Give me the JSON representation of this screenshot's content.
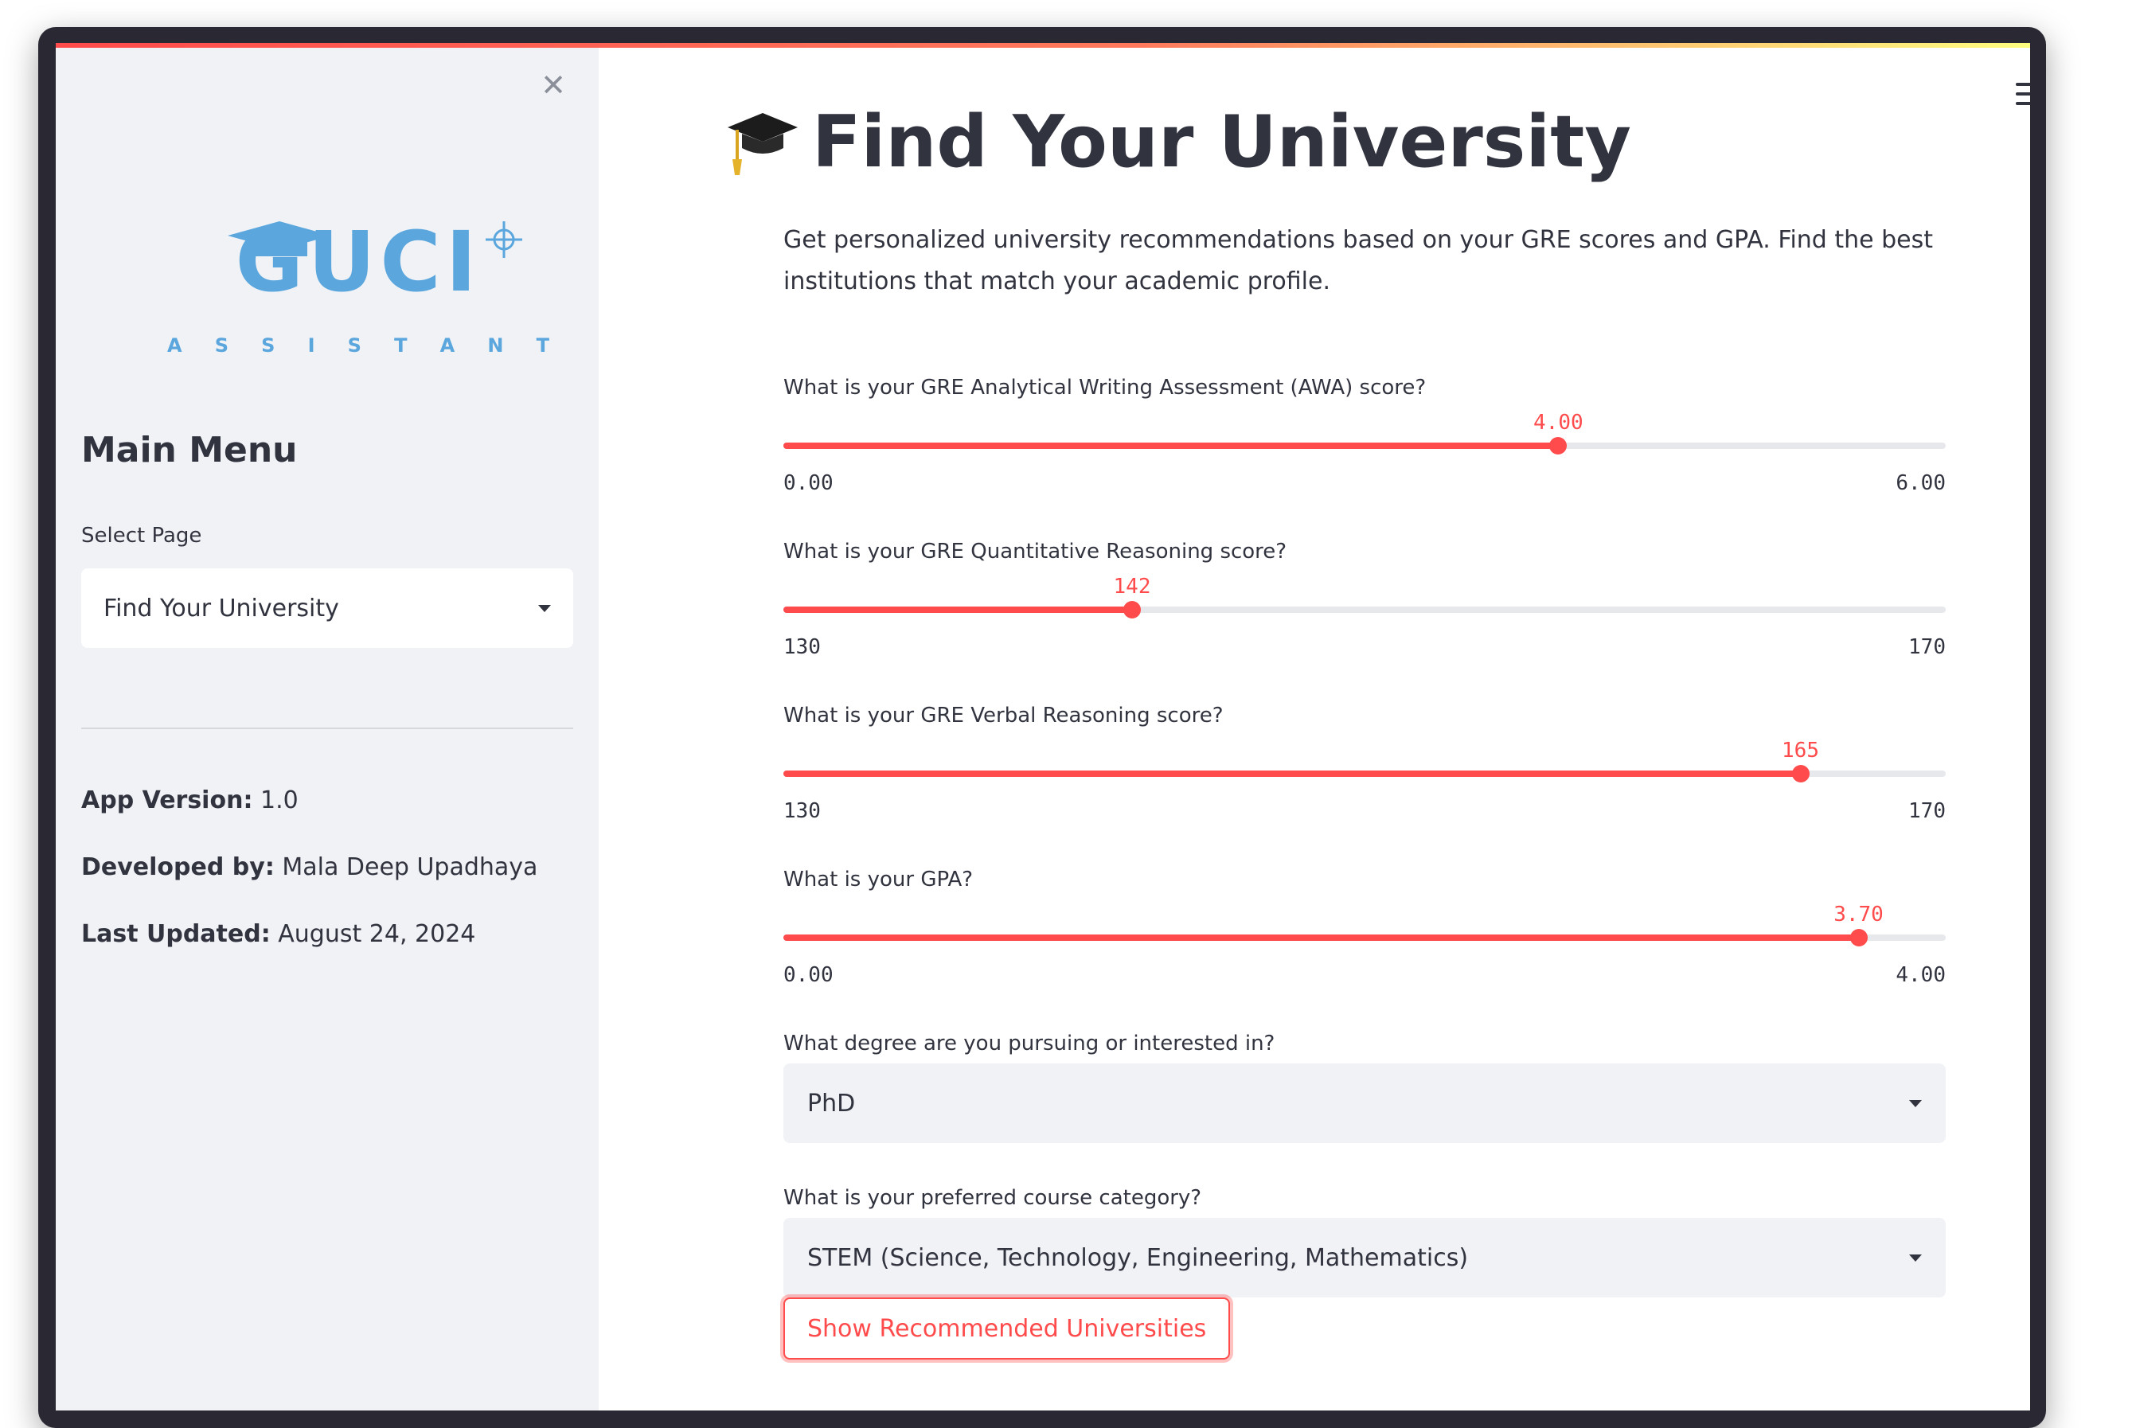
{
  "sidebar": {
    "logo_text": "GUCI",
    "logo_subtext": [
      "A",
      "S",
      "S",
      "I",
      "S",
      "T",
      "A",
      "N",
      "T"
    ],
    "menu_heading": "Main Menu",
    "select_label": "Select Page",
    "selected_page": "Find Your University",
    "app_version_label": "App Version:",
    "app_version_value": "1.0",
    "developed_by_label": "Developed by:",
    "developed_by_value": "Mala Deep Upadhaya",
    "last_updated_label": "Last Updated:",
    "last_updated_value": "August 24, 2024"
  },
  "main": {
    "title": "Find Your University",
    "intro": "Get personalized university recommendations based on your GRE scores and GPA. Find the best institutions that match your academic profile.",
    "sliders": [
      {
        "label": "What is your GRE Analytical Writing Assessment (AWA) score?",
        "value": "4.00",
        "num": 4.0,
        "min": "0.00",
        "max": "6.00",
        "min_num": 0,
        "max_num": 6
      },
      {
        "label": "What is your GRE Quantitative Reasoning score?",
        "value": "142",
        "num": 142,
        "min": "130",
        "max": "170",
        "min_num": 130,
        "max_num": 170
      },
      {
        "label": "What is your GRE Verbal Reasoning score?",
        "value": "165",
        "num": 165,
        "min": "130",
        "max": "170",
        "min_num": 130,
        "max_num": 170
      },
      {
        "label": "What is your GPA?",
        "value": "3.70",
        "num": 3.7,
        "min": "0.00",
        "max": "4.00",
        "min_num": 0,
        "max_num": 4
      }
    ],
    "degree_label": "What degree are you pursuing or interested in?",
    "degree_value": "PhD",
    "course_label": "What is your preferred course category?",
    "course_value": "STEM (Science, Technology, Engineering, Mathematics)",
    "button_label": "Show Recommended Universities"
  },
  "icons": {
    "close": "close-icon",
    "menu": "hamburger-menu-icon",
    "title_icon": "graduation-cap-icon",
    "dropdown": "chevron-down-icon"
  },
  "colors": {
    "accent": "#ff4b4b",
    "sidebar_bg": "#f0f2f6",
    "text": "#31333f",
    "logo_blue": "#5aa6dd"
  }
}
